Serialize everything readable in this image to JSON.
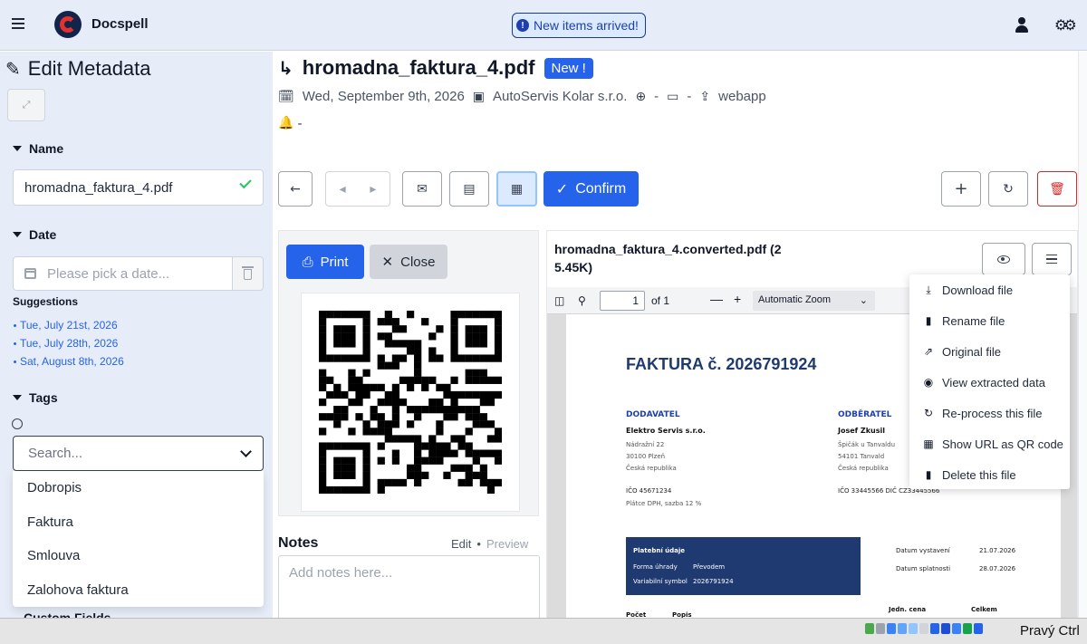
{
  "app": {
    "title": "Docspell",
    "notification": "New items arrived!"
  },
  "sidebar": {
    "title": "Edit Metadata",
    "name_section": "Name",
    "name_value": "hromadna_faktura_4.pdf",
    "date_section": "Date",
    "date_placeholder": "Please pick a date...",
    "suggestions_label": "Suggestions",
    "suggestions": [
      "Tue, July 21st, 2026",
      "Tue, July 28th, 2026",
      "Sat, August 8th, 2026"
    ],
    "tags_section": "Tags",
    "tag_search_placeholder": "Search...",
    "tag_options": [
      "Dobropis",
      "Faktura",
      "Smlouva",
      "Zalohova faktura"
    ],
    "custom_fields": "Custom Fields"
  },
  "document": {
    "title": "hromadna_faktura_4.pdf",
    "badge": "New !",
    "date": "Wed, September 9th, 2026",
    "correspondent": "AutoServis Kolar s.r.o.",
    "concerning": "-",
    "folder": "-",
    "source": "webapp",
    "due": "-"
  },
  "toolbar": {
    "confirm_label": "Confirm"
  },
  "qr": {
    "print_label": "Print",
    "close_label": "Close"
  },
  "notes": {
    "label": "Notes",
    "edit_tab": "Edit",
    "separator": "•",
    "preview_tab": "Preview",
    "placeholder": "Add notes here..."
  },
  "pdf": {
    "filename": "hromadna_faktura_4.converted.pdf (2 5.45K)",
    "page_value": "1",
    "page_count": "of 1",
    "zoom": "Automatic Zoom",
    "invoice_title": "FAKTURA č. 2026791924",
    "supplier_head": "DODAVATEL",
    "supplier_name": "Elektro Servis s.r.o.",
    "supplier_addr1": "Nádražní 22",
    "supplier_addr2": "30100 Plzeň",
    "supplier_addr3": "Česká republika",
    "supplier_ico": "IČO 45671234",
    "supplier_vat": "Plátce DPH, sazba 12 %",
    "buyer_head": "ODBĚRATEL",
    "buyer_name": "Josef Zkusil",
    "buyer_addr1": "Špičák u Tanvaldu",
    "buyer_addr2": "54101 Tanvald",
    "buyer_addr3": "Česká republika",
    "buyer_ico": "IČO 33445566  DIČ CZ33445566",
    "payment_head": "Platební údaje",
    "payment_form_label": "Forma úhrady",
    "payment_form_value": "Převodem",
    "var_symbol_label": "Variabilní symbol",
    "var_symbol_value": "2026791924",
    "issued_label": "Datum vystavení",
    "issued_value": "21.07.2026",
    "due_label": "Datum splatnosti",
    "due_value": "28.07.2026",
    "col_qty": "Počet",
    "col_desc": "Popis",
    "col_unit": "Jedn. cena",
    "col_total": "Celkem"
  },
  "menu": {
    "items": [
      "Download file",
      "Rename file",
      "Original file",
      "View extracted data",
      "Re-process this file",
      "Show URL as QR code",
      "Delete this file"
    ]
  },
  "taskbar": {
    "label": "Pravý Ctrl"
  }
}
